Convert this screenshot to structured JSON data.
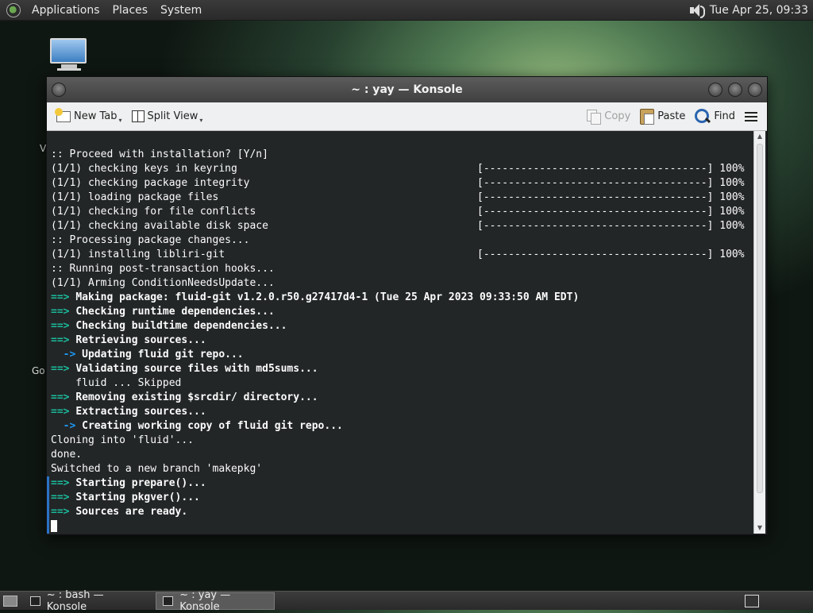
{
  "top_panel": {
    "menus": [
      "Applications",
      "Places",
      "System"
    ],
    "clock": "Tue Apr 25, 09:33"
  },
  "desktop": {
    "fragments": [
      "V",
      "Go"
    ]
  },
  "window": {
    "title": "~ : yay — Konsole",
    "toolbar": {
      "new_tab": "New Tab",
      "split_view": "Split View",
      "copy": "Copy",
      "paste": "Paste",
      "find": "Find"
    }
  },
  "terminal": {
    "lines": [
      {
        "text": ":: Proceed with installation? [Y/n]"
      },
      {
        "text": "(1/1) checking keys in keyring",
        "progress": "[------------------------------------] 100%"
      },
      {
        "text": "(1/1) checking package integrity",
        "progress": "[------------------------------------] 100%"
      },
      {
        "text": "(1/1) loading package files",
        "progress": "[------------------------------------] 100%"
      },
      {
        "text": "(1/1) checking for file conflicts",
        "progress": "[------------------------------------] 100%"
      },
      {
        "text": "(1/1) checking available disk space",
        "progress": "[------------------------------------] 100%"
      },
      {
        "text": ":: Processing package changes..."
      },
      {
        "text": "(1/1) installing libliri-git",
        "progress": "[------------------------------------] 100%"
      },
      {
        "text": ":: Running post-transaction hooks..."
      },
      {
        "text": "(1/1) Arming ConditionNeedsUpdate..."
      },
      {
        "prefix": "==> ",
        "text": "Making package: fluid-git v1.2.0.r50.g27417d4-1 (Tue 25 Apr 2023 09:33:50 AM EDT)",
        "bold": true
      },
      {
        "prefix": "==> ",
        "text": "Checking runtime dependencies...",
        "bold": true
      },
      {
        "prefix": "==> ",
        "text": "Checking buildtime dependencies...",
        "bold": true
      },
      {
        "prefix": "==> ",
        "text": "Retrieving sources...",
        "bold": true
      },
      {
        "prefix": "  -> ",
        "text": "Updating fluid git repo...",
        "bold": true,
        "blue": true
      },
      {
        "prefix": "==> ",
        "text": "Validating source files with md5sums...",
        "bold": true
      },
      {
        "text": "    fluid ... Skipped"
      },
      {
        "prefix": "==> ",
        "text": "Removing existing $srcdir/ directory...",
        "bold": true
      },
      {
        "prefix": "==> ",
        "text": "Extracting sources...",
        "bold": true
      },
      {
        "prefix": "  -> ",
        "text": "Creating working copy of fluid git repo...",
        "bold": true,
        "blue": true
      },
      {
        "text": "Cloning into 'fluid'..."
      },
      {
        "text": "done."
      },
      {
        "text": "Switched to a new branch 'makepkg'"
      },
      {
        "prefix": "==> ",
        "text": "Starting prepare()...",
        "bold": true,
        "marked": true
      },
      {
        "prefix": "==> ",
        "text": "Starting pkgver()...",
        "bold": true,
        "marked": true
      },
      {
        "prefix": "==> ",
        "text": "Sources are ready.",
        "bold": true,
        "marked": true
      }
    ]
  },
  "taskbar": {
    "tasks": [
      {
        "label": "~ : bash — Konsole",
        "active": false
      },
      {
        "label": "~ : yay — Konsole",
        "active": true
      }
    ]
  }
}
